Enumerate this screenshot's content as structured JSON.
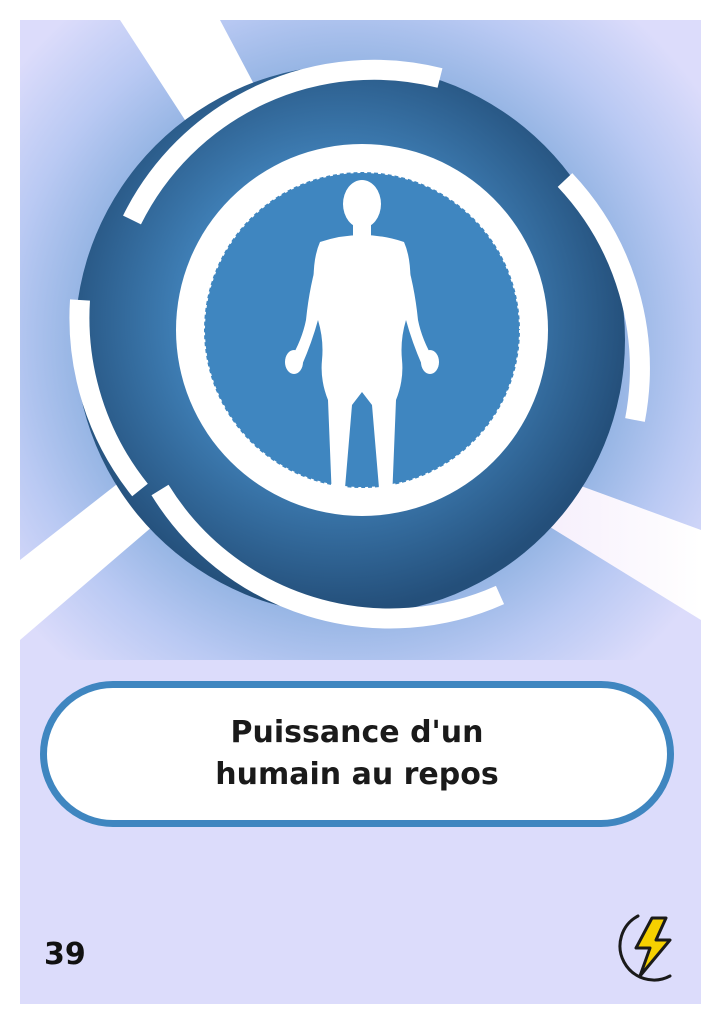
{
  "card": {
    "title_line1": "Puissance d'un",
    "title_line2": "humain au repos",
    "number": "39"
  },
  "icons": {
    "center": "human-body-silhouette-icon",
    "corner": "lightning-moon-logo-icon"
  },
  "colors": {
    "background": "#dcdcfb",
    "ring": "#3f86c0",
    "ring_dark": "#2a5f8f",
    "title_border": "#3f86c0",
    "logo_fill": "#f5d000"
  }
}
